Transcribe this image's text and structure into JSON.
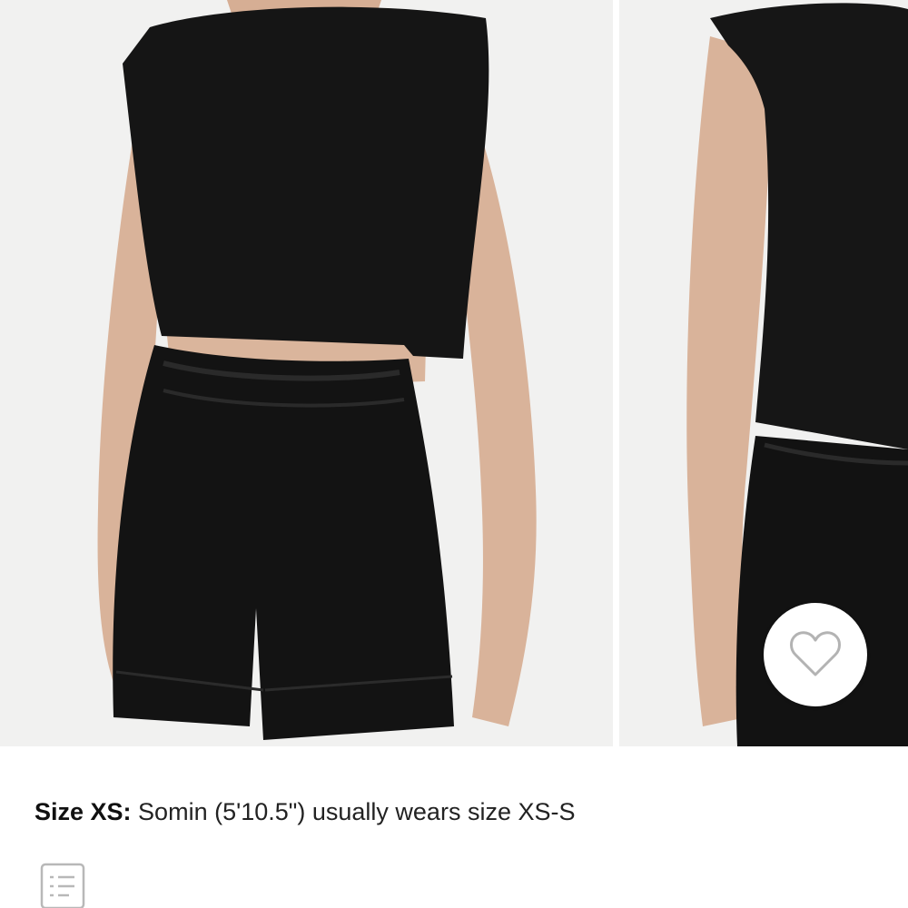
{
  "product_gallery": {
    "images": [
      {
        "alt": "model-front-view",
        "icon": "product-photo"
      },
      {
        "alt": "model-side-view",
        "icon": "product-photo"
      }
    ],
    "favorite_icon": "heart-outline-icon"
  },
  "fit": {
    "size_label": "Size XS:",
    "description": " Somin (5'10.5\") usually wears size XS-S"
  },
  "details": {
    "icon": "notes-list-icon"
  },
  "colors": {
    "garment": "#141414",
    "background": "#f1f1f0",
    "skin": "#dcb49a",
    "icon_gray": "#b8b8b8"
  }
}
